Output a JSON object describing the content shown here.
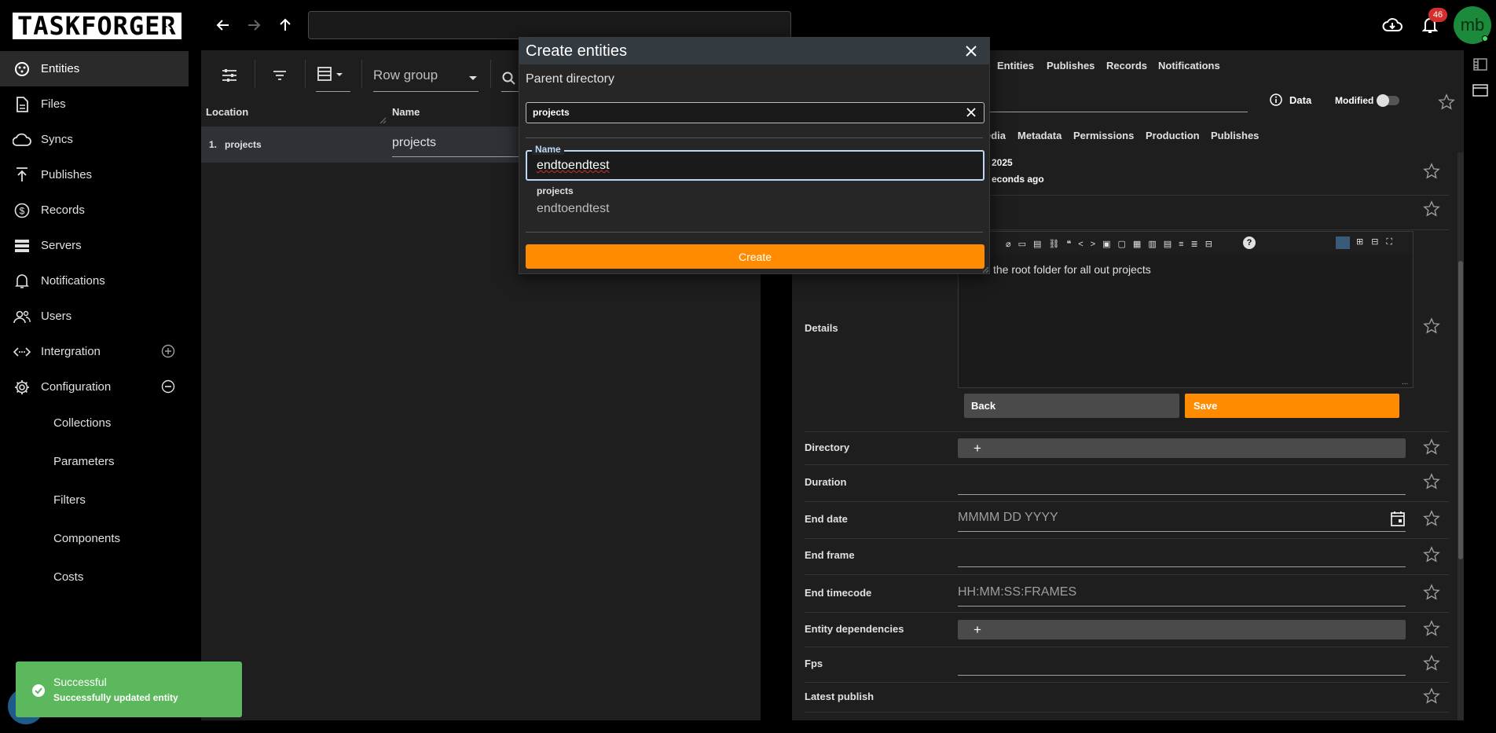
{
  "app": {
    "logo_text": "TASKFORGER",
    "notification_count": "46",
    "avatar_initials": "mb"
  },
  "sidebar": {
    "items": [
      {
        "label": "Entities",
        "icon": "entities-icon"
      },
      {
        "label": "Files",
        "icon": "file-icon"
      },
      {
        "label": "Syncs",
        "icon": "cloud-sync-icon"
      },
      {
        "label": "Publishes",
        "icon": "publish-icon"
      },
      {
        "label": "Records",
        "icon": "dollar-icon"
      },
      {
        "label": "Servers",
        "icon": "servers-icon"
      },
      {
        "label": "Notifications",
        "icon": "bell-icon"
      },
      {
        "label": "Users",
        "icon": "users-icon"
      },
      {
        "label": "Intergration",
        "icon": "integration-icon"
      },
      {
        "label": "Configuration",
        "icon": "gear-icon"
      }
    ],
    "subitems": [
      "Collections",
      "Parameters",
      "Filters",
      "Components",
      "Costs"
    ]
  },
  "main": {
    "row_group_label": "Row group",
    "columns": [
      "Location",
      "Name"
    ],
    "rows": [
      {
        "index": "1.",
        "location": "projects",
        "name": "projects"
      }
    ]
  },
  "right_panel": {
    "top_tabs": [
      "Entities",
      "Publishes",
      "Records",
      "Notifications"
    ],
    "data_label": "Data",
    "modified_label": "Modified",
    "sub_tabs": [
      "edia",
      "Metadata",
      "Permissions",
      "Production",
      "Publishes"
    ],
    "date_fragment": "2025",
    "relative_time": "econds ago",
    "details_text": "is the root folder for all out projects",
    "back_label": "Back",
    "save_label": "Save",
    "fields": [
      {
        "label": "Details"
      },
      {
        "label": "Directory"
      },
      {
        "label": "Duration"
      },
      {
        "label": "End date",
        "placeholder": "MMMM DD YYYY"
      },
      {
        "label": "End frame"
      },
      {
        "label": "End timecode",
        "placeholder": "HH:MM:SS:FRAMES"
      },
      {
        "label": "Entity dependencies"
      },
      {
        "label": "Fps"
      },
      {
        "label": "Latest publish"
      }
    ]
  },
  "dialog": {
    "title": "Create entities",
    "parent_label": "Parent directory",
    "parent_value": "projects",
    "name_label": "Name",
    "name_value": "endtoendtest",
    "preview_parent": "projects",
    "preview_name": "endtoendtest",
    "create_label": "Create"
  },
  "toast": {
    "title": "Successful",
    "message": "Successfully updated entity"
  },
  "colors": {
    "accent": "#ff8c00",
    "toast": "#5cb85c",
    "badge": "#d32f2f",
    "avatar": "#1b8a3b"
  }
}
